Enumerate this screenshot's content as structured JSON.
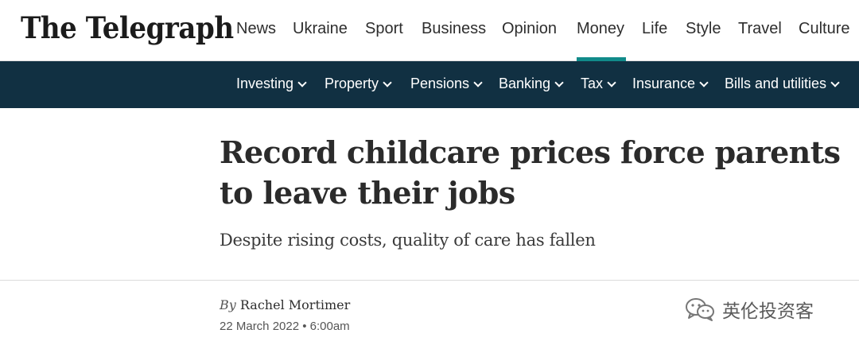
{
  "brand": {
    "logo_text": "The Telegraph"
  },
  "main_nav": {
    "items": [
      "News",
      "Ukraine",
      "Sport",
      "Business",
      "Opinion",
      "Money",
      "Life",
      "Style",
      "Travel",
      "Culture"
    ],
    "active": "Money"
  },
  "sub_nav": {
    "items": [
      "Investing",
      "Property",
      "Pensions",
      "Banking",
      "Tax",
      "Insurance",
      "Bills and utilities"
    ],
    "icon": "chevron-down-icon"
  },
  "article": {
    "headline": "Record childcare prices force parents to leave their jobs",
    "standfirst": "Despite rising costs, quality of care has fallen",
    "byline_prefix": "By",
    "author": "Rachel Mortimer",
    "date": "22 March 2022 • 6:00am"
  },
  "watermark": {
    "text": "英伦投资客",
    "icon": "wechat-icon"
  },
  "colors": {
    "subnav_bg": "#113042",
    "active_accent": "#118b8a",
    "text": "#2e2e2e"
  }
}
